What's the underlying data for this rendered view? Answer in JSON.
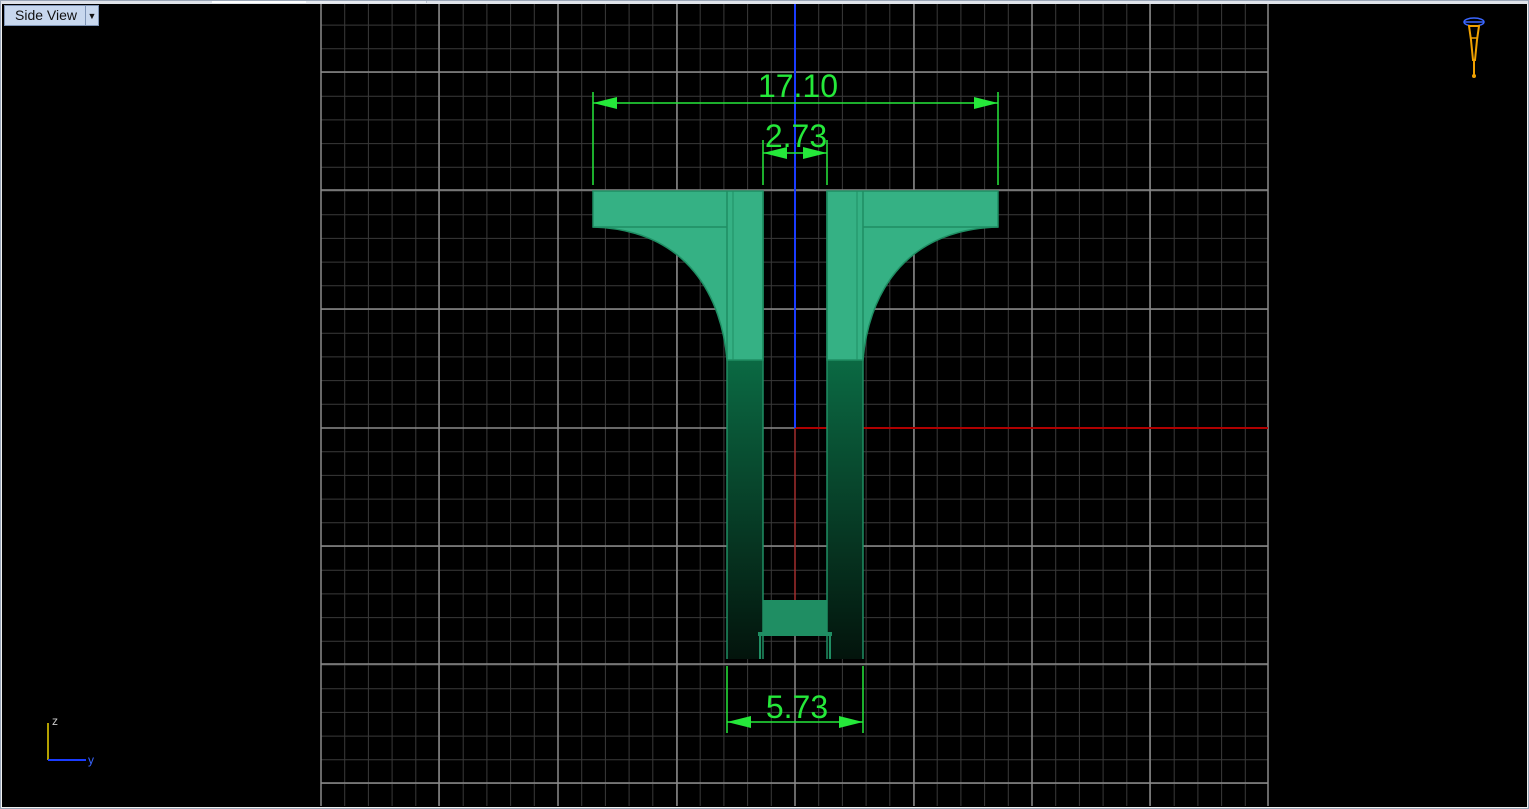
{
  "viewport": {
    "title": "Side View",
    "menu_icon": "chevron-down-icon"
  },
  "dimensions": [
    {
      "label": "17.10"
    },
    {
      "label": "2.73"
    },
    {
      "label": "5.73"
    }
  ],
  "axis_widget": {
    "vertical_label": "z",
    "horizontal_label": "y"
  },
  "gumball_icon": "camera-icon",
  "colors": {
    "background": "#000000",
    "grid_minor": "#3a3a3a",
    "grid_major": "#8a8a8a",
    "x_axis": "#b00000",
    "y_axis": "#1a3cff",
    "model_fill": "#35b184",
    "dimension": "#25e83a"
  }
}
